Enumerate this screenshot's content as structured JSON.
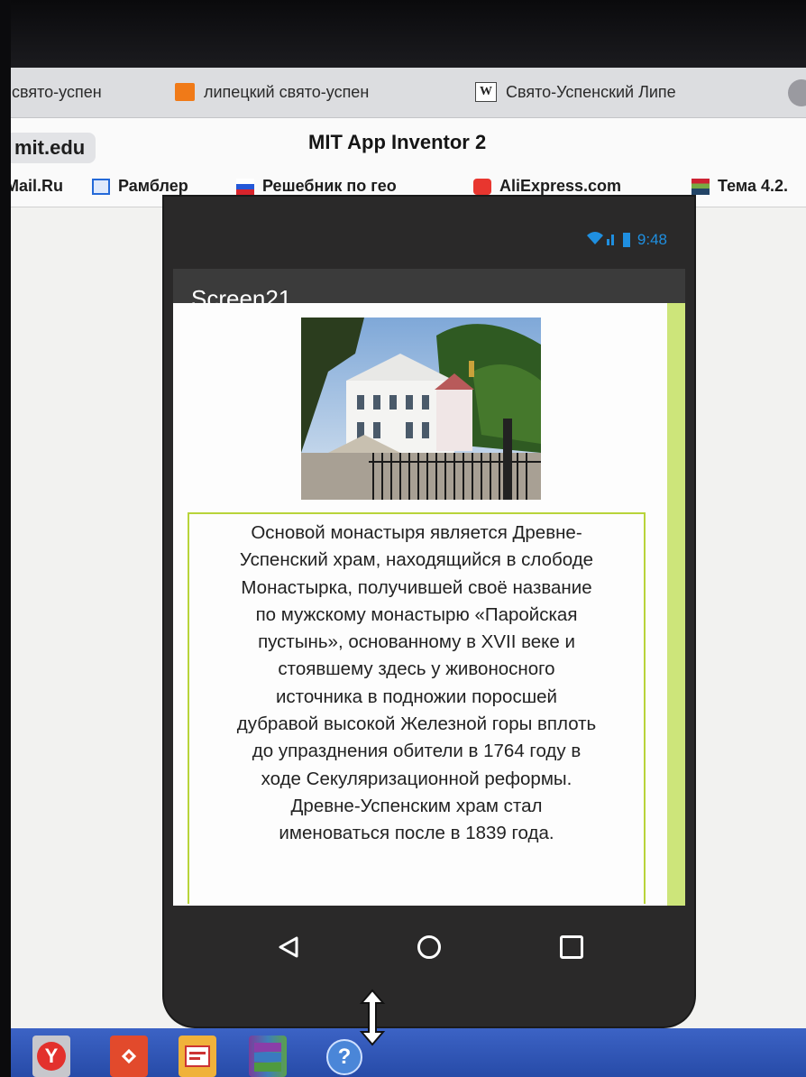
{
  "browser": {
    "tabs": [
      {
        "label": "i свято-успен",
        "icon": "tab-favicon"
      },
      {
        "label": "липецкий свято-успен",
        "icon": "photo-favicon"
      },
      {
        "label": "Свято-Успенский Липе",
        "icon": "wikipedia-favicon",
        "icon_glyph": "W"
      }
    ],
    "url": "mit.edu",
    "title": "MIT App Inventor 2",
    "bookmarks": [
      {
        "label": "Mail.Ru"
      },
      {
        "label": "Рамблер"
      },
      {
        "label": "Решебник по гео"
      },
      {
        "label": "AliExpress.com"
      },
      {
        "label": "Тема 4.2."
      }
    ]
  },
  "phone": {
    "status": {
      "time": "9:48"
    },
    "screen_title": "Screen21",
    "description": "Основой монастыря является Древне-\nУспенский храм, находящийся в слободе\nМонастырка, получившей своё название\nпо мужскому монастырю «Паройская\nпустынь», основанному в XVII веке и\nстоявшему здесь у живоносного\nисточника в подножии поросшей\nдубравой высокой Железной горы вплоть\nдо упразднения обители в 1764 году в\nходе Секуляризационной реформы.\nДревне-Успенским храм стал\nименоваться после в 1839 года.",
    "nav": {
      "back": "◁"
    }
  },
  "taskbar": {
    "apps": [
      "yandex-browser",
      "anydesk",
      "pdf-reader",
      "winrar",
      "help"
    ],
    "yandex_glyph": "Y",
    "help_glyph": "?"
  },
  "colors": {
    "accent_green": "#cde57a",
    "border_green": "#b8d43a",
    "status_blue": "#1f8fe0",
    "taskbar_blue": "#2f55b6"
  }
}
